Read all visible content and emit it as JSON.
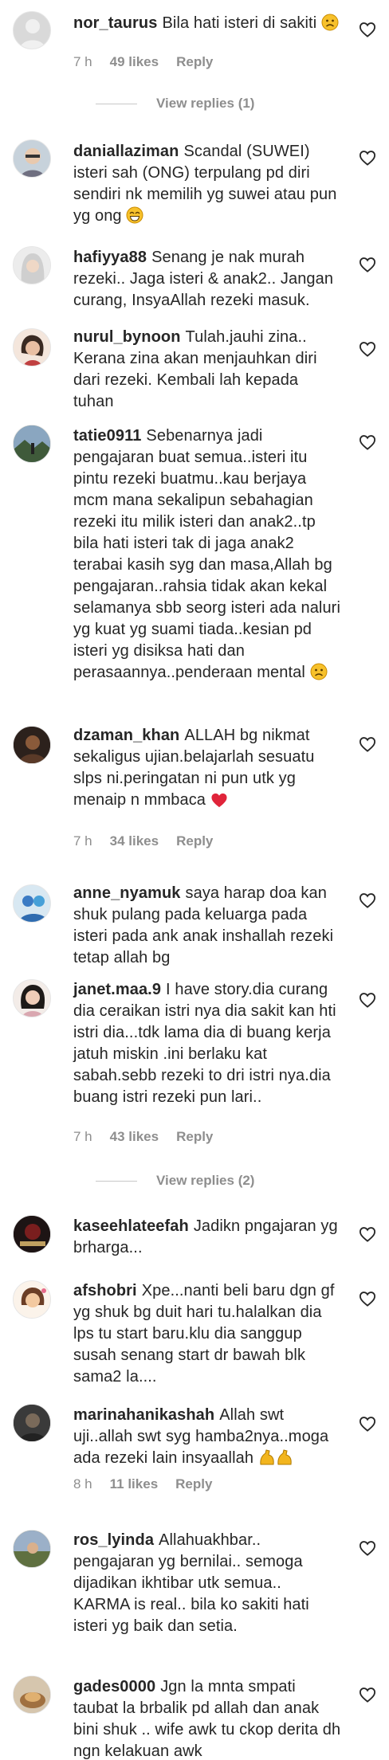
{
  "comments": [
    {
      "user": "nor_taurus",
      "text": "Bila hati isteri di sakiti",
      "emoji_after": "sad",
      "time": "7 h",
      "likes": "49 likes",
      "reply": "Reply",
      "view_replies": "View replies (1)",
      "avatar": "gray"
    },
    {
      "user": "daniallaziman",
      "text": "Scandal (SUWEI) isteri sah (ONG) terpulang pd diri sendiri nk memilih yg suwei atau pun yg ong",
      "emoji_after": "grin",
      "avatar": "glasses"
    },
    {
      "user": "hafiyya88",
      "text": "Senang je nak murah rezeki.. Jaga isteri & anak2.. Jangan curang, InsyaAllah rezeki masuk.",
      "avatar": "hijab"
    },
    {
      "user": "nurul_bynoon",
      "text": "Tulah.jauhi zina.. Kerana zina akan menjauhkan diri dari rezeki. Kembali lah kepada tuhan",
      "avatar": "woman"
    },
    {
      "user": "tatie0911",
      "text": "Sebenarnya jadi pengajaran buat semua..isteri itu pintu rezeki buatmu..kau berjaya mcm mana sekalipun sebahagian rezeki itu milik isteri dan anak2..tp bila hati isteri tak di jaga anak2 terabai kasih syg dan masa,Allah bg pengajaran..rahsia tidak akan kekal selamanya sbb seorg isteri ada naluri yg kuat yg suami tiada..kesian pd isteri yg disiksa hati dan perasaannya..penderaan mental",
      "emoji_after": "sad2",
      "avatar": "landscape"
    },
    {
      "user": "dzaman_khan",
      "text": "ALLAH bg nikmat sekaligus ujian.belajarlah sesuatu slps ni.peringatan ni pun utk yg menaip n mmbaca",
      "emoji_after": "heart",
      "time": "7 h",
      "likes": "34 likes",
      "reply": "Reply",
      "avatar": "dark"
    },
    {
      "user": "anne_nyamuk",
      "text": "saya harap doa kan shuk pulang pada keluarga pada isteri pada ank anak inshallah rezeki tetap allah bg",
      "avatar": "blue"
    },
    {
      "user": "janet.maa.9",
      "text": "I have story.dia curang dia ceraikan istri nya dia sakit kan hti istri dia...tdk lama dia di buang kerja jatuh miskin .ini berlaku kat sabah.sebb rezeki to dri istri nya.dia buang istri rezeki pun lari..",
      "time": "7 h",
      "likes": "43 likes",
      "reply": "Reply",
      "view_replies": "View replies (2)",
      "avatar": "girl"
    },
    {
      "user": "kaseehlateefah",
      "text": "Jadikn pngajaran yg brharga...",
      "avatar": "darkred"
    },
    {
      "user": "afshobri",
      "text": "Xpe...nanti beli baru dgn gf yg shuk bg duit hari tu.halalkan dia lps tu start baru.klu dia sanggup susah senang start dr bawah blk sama2 la....",
      "avatar": "cartoon"
    },
    {
      "user": "marinahanikashah",
      "text": "Allah swt uji..allah swt syg hamba2nya..moga ada rezeki lain insyaallah",
      "emoji_after": "muscle",
      "time": "8 h",
      "likes": "11 likes",
      "reply": "Reply",
      "avatar": "dark2"
    },
    {
      "user": "ros_lyinda",
      "text": "Allahuakhbar.. pengajaran yg bernilai.. semoga dijadikan ikhtibar utk semua.. KARMA is real.. bila ko sakiti hati isteri yg baik dan setia.",
      "avatar": "outdoor"
    },
    {
      "user": "gades0000",
      "text": "Jgn la mnta smpati taubat la brbalik pd allah dan anak bini shuk .. wife awk tu ckop derita dh ngn kelakuan awk",
      "avatar": "food"
    }
  ]
}
